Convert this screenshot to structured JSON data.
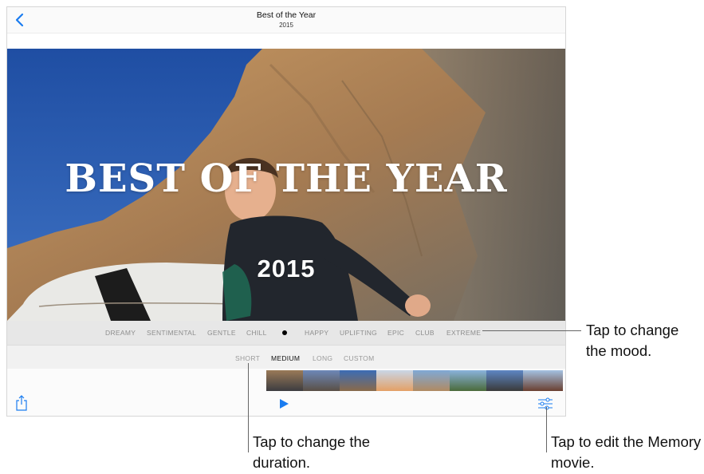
{
  "nav": {
    "title": "Best of the Year",
    "subtitle": "2015",
    "back_icon": "chevron-left-icon"
  },
  "hero": {
    "title": "BEST OF THE YEAR",
    "year": "2015"
  },
  "mood": {
    "options": [
      "DREAMY",
      "SENTIMENTAL",
      "GENTLE",
      "CHILL",
      "HAPPY",
      "UPLIFTING",
      "EPIC",
      "CLUB",
      "EXTREME"
    ],
    "selected_index": 4
  },
  "duration": {
    "options": [
      "SHORT",
      "MEDIUM",
      "LONG",
      "CUSTOM"
    ],
    "selected": "MEDIUM"
  },
  "toolbar": {
    "share_icon": "share-icon",
    "play_icon": "play-icon",
    "edit_icon": "sliders-icon"
  },
  "callouts": {
    "mood": "Tap to change the mood.",
    "duration": "Tap to change the duration.",
    "edit": "Tap to edit the Memory movie."
  },
  "colors": {
    "accent": "#1a7cf0",
    "sky": "#2f5fb3",
    "cliff": "#b58a5b"
  }
}
